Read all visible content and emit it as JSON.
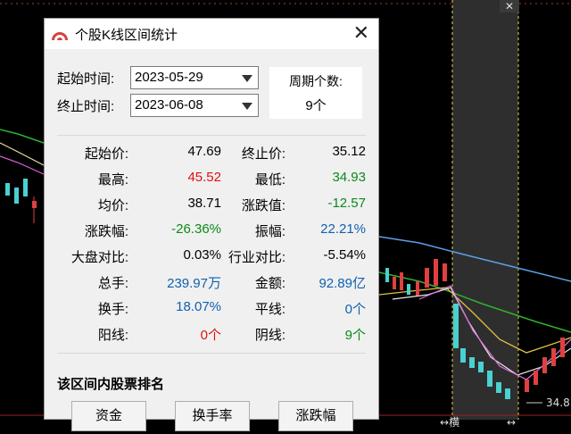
{
  "chart": {
    "label_price": "34.8",
    "label_bottom": "横"
  },
  "dialog": {
    "title": "个股K线区间统计",
    "close": "✕",
    "start_label": "起始时间:",
    "start_value": "2023-05-29",
    "end_label": "终止时间:",
    "end_value": "2023-06-08",
    "period_label": "周期个数:",
    "period_value": "9个",
    "stats": {
      "start_price_label": "起始价:",
      "start_price": "47.69",
      "end_price_label": "终止价:",
      "end_price": "35.12",
      "high_label": "最高:",
      "high": "45.52",
      "low_label": "最低:",
      "low": "34.93",
      "avg_label": "均价:",
      "avg": "38.71",
      "change_label": "涨跌值:",
      "change": "-12.57",
      "pct_label": "涨跌幅:",
      "pct": "-26.36%",
      "amp_label": "振幅:",
      "amp": "22.21%",
      "market_label": "大盘对比:",
      "market": "0.03%",
      "industry_label": "行业对比:",
      "industry": "-5.54%",
      "volume_label": "总手:",
      "volume": "239.97万",
      "amount_label": "金额:",
      "amount": "92.89亿",
      "turnover_label": "换手:",
      "turnover": "18.07%",
      "flat_label": "平线:",
      "flat": "0个",
      "up_label": "阳线:",
      "up": "0个",
      "down_label": "阴线:",
      "down": "9个"
    },
    "rank_title": "该区间内股票排名",
    "buttons": [
      "资金",
      "换手率",
      "涨跌幅"
    ]
  }
}
